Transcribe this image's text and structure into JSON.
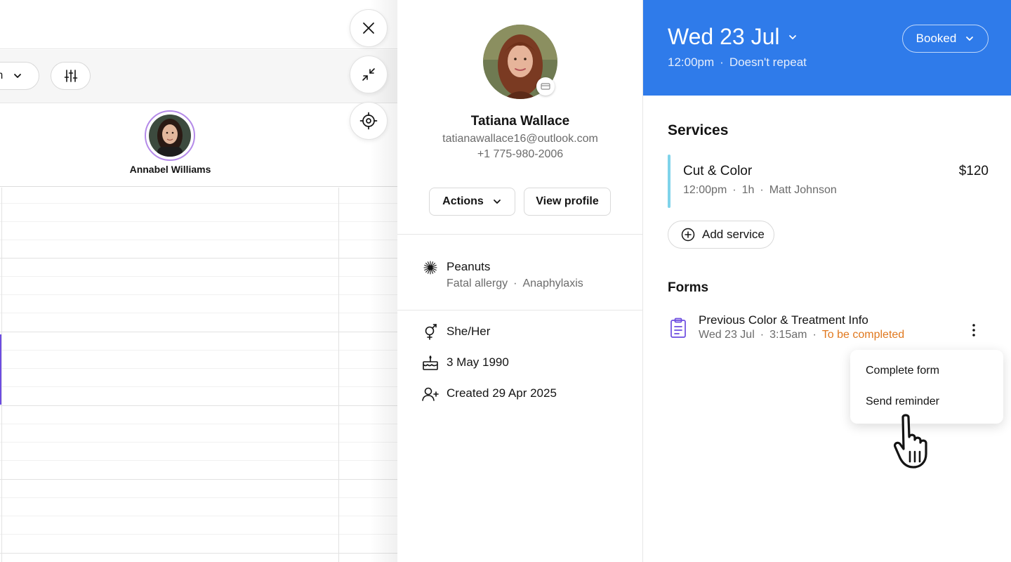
{
  "calendar": {
    "view_dropdown_label": "m",
    "team_member_name": "Annabel Williams"
  },
  "client": {
    "name": "Tatiana Wallace",
    "email": "tatianawallace16@outlook.com",
    "phone": "+1 775-980-2006",
    "actions_label": "Actions",
    "view_profile_label": "View profile",
    "allergy": {
      "name": "Peanuts",
      "severity": "Fatal allergy",
      "reaction": "Anaphylaxis"
    },
    "pronouns": "She/Her",
    "birthday": "3 May 1990",
    "created": "Created 29 Apr 2025"
  },
  "appointment": {
    "date": "Wed 23 Jul",
    "time": "12:00pm",
    "repeat": "Doesn't repeat",
    "status": "Booked",
    "header_color": "#2f7bea",
    "services_title": "Services",
    "service": {
      "name": "Cut & Color",
      "price": "$120",
      "time": "12:00pm",
      "duration": "1h",
      "staff": "Matt Johnson",
      "accent_color": "#7fd3ea"
    },
    "add_service_label": "Add service",
    "forms_title": "Forms",
    "form": {
      "title": "Previous Color & Treatment Info",
      "date": "Wed 23 Jul",
      "time": "3:15am",
      "status": "To be completed",
      "status_color": "#e0781e"
    },
    "form_menu": {
      "complete_label": "Complete form",
      "reminder_label": "Send reminder"
    }
  },
  "icons": {
    "close": "close-icon",
    "collapse": "collapse-icon",
    "locate": "crosshair-icon",
    "filter": "sliders-icon",
    "allergy": "allergy-burst-icon",
    "pronouns": "gender-icon",
    "birthday": "cake-icon",
    "created": "user-plus-icon",
    "form": "clipboard-icon",
    "more": "more-vertical-icon",
    "cursor": "hand-pointer-cursor"
  }
}
